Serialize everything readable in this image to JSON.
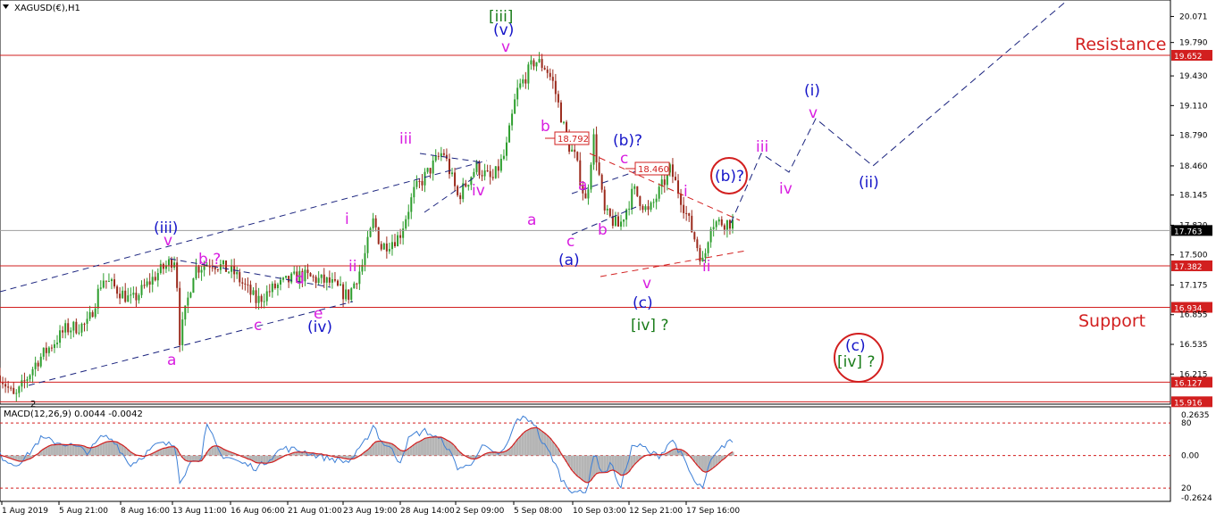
{
  "header": {
    "symbol_label": "XAGUSD(€),H1"
  },
  "colors": {
    "candle_up": "#2e9e2e",
    "candle_down": "#9b2a1c",
    "level_line": "#d21f1f",
    "trend_line": "#1a237e",
    "minor_wave": "#d81ee0",
    "major_wave": "#1515c8",
    "degree_wave": "#1b7d1b",
    "macd_line": "#3d7fd6",
    "macd_signal": "#d21f1f",
    "macd_hist": "#b5b5b5",
    "projection": "#1a237e",
    "annotation_text": "#d21f1f"
  },
  "chart_data": [
    {
      "type": "candlestick",
      "title": "XAGUSD(€),H1",
      "ylim": [
        15.9,
        20.21
      ],
      "y_ticks": [
        "20.071",
        "19.790",
        "19.652",
        "19.430",
        "19.110",
        "18.790",
        "18.460",
        "18.145",
        "17.820",
        "17.763",
        "17.500",
        "17.382",
        "17.175",
        "16.934",
        "16.855",
        "16.535",
        "16.215",
        "16.127",
        "15.916"
      ],
      "x_ticks": [
        "1 Aug 2019",
        "5 Aug 21:00",
        "8 Aug 16:00",
        "13 Aug 11:00",
        "16 Aug 06:00",
        "21 Aug 01:00",
        "23 Aug 19:00",
        "28 Aug 14:00",
        "2 Sep 09:00",
        "5 Sep 08:00",
        "10 Sep 03:00",
        "12 Sep 21:00",
        "17 Sep 16:00"
      ],
      "price_path": [
        {
          "t": 0,
          "p": 16.2
        },
        {
          "t": 0.02,
          "p": 15.95
        },
        {
          "t": 0.05,
          "p": 16.35
        },
        {
          "t": 0.09,
          "p": 16.7
        },
        {
          "t": 0.12,
          "p": 16.75
        },
        {
          "t": 0.14,
          "p": 17.25
        },
        {
          "t": 0.18,
          "p": 17.0
        },
        {
          "t": 0.215,
          "p": 17.3
        },
        {
          "t": 0.24,
          "p": 17.48
        },
        {
          "t": 0.245,
          "p": 16.58
        },
        {
          "t": 0.265,
          "p": 17.35
        },
        {
          "t": 0.29,
          "p": 17.42
        },
        {
          "t": 0.32,
          "p": 17.3
        },
        {
          "t": 0.35,
          "p": 17.0
        },
        {
          "t": 0.375,
          "p": 17.15
        },
        {
          "t": 0.41,
          "p": 17.28
        },
        {
          "t": 0.45,
          "p": 17.2
        },
        {
          "t": 0.475,
          "p": 17.05
        },
        {
          "t": 0.495,
          "p": 17.4
        },
        {
          "t": 0.51,
          "p": 17.88
        },
        {
          "t": 0.52,
          "p": 17.58
        },
        {
          "t": 0.545,
          "p": 17.7
        },
        {
          "t": 0.565,
          "p": 18.18
        },
        {
          "t": 0.605,
          "p": 18.62
        },
        {
          "t": 0.625,
          "p": 18.12
        },
        {
          "t": 0.65,
          "p": 18.45
        },
        {
          "t": 0.672,
          "p": 18.3
        },
        {
          "t": 0.69,
          "p": 18.6
        },
        {
          "t": 0.705,
          "p": 19.25
        },
        {
          "t": 0.73,
          "p": 19.6
        },
        {
          "t": 0.745,
          "p": 19.52
        },
        {
          "t": 0.755,
          "p": 19.35
        },
        {
          "t": 0.775,
          "p": 18.7
        },
        {
          "t": 0.785,
          "p": 18.55
        },
        {
          "t": 0.8,
          "p": 18.05
        },
        {
          "t": 0.81,
          "p": 18.78
        },
        {
          "t": 0.825,
          "p": 17.95
        },
        {
          "t": 0.845,
          "p": 17.8
        },
        {
          "t": 0.865,
          "p": 18.2
        },
        {
          "t": 0.885,
          "p": 17.95
        },
        {
          "t": 0.915,
          "p": 18.42
        },
        {
          "t": 0.93,
          "p": 18.1
        },
        {
          "t": 0.96,
          "p": 17.4
        },
        {
          "t": 0.97,
          "p": 17.85
        },
        {
          "t": 1.0,
          "p": 17.85
        }
      ],
      "horizontal_levels": [
        19.652,
        17.382,
        16.934,
        16.127,
        15.916
      ],
      "current_price": 17.763,
      "level_labels": [
        "19.652",
        "17.382",
        "16.934",
        "16.127",
        "15.916",
        "17.763"
      ],
      "annotations": {
        "resistance": "Resistance",
        "support": "Support",
        "box_1": "18.792",
        "box_2": "18.460"
      },
      "waves": {
        "iii_major": "[iii]",
        "v_major": "(v)",
        "v_minor_top": "v",
        "iii_circle": "(iii)",
        "v_left": "v",
        "a_low": "a",
        "b_q": "b ?",
        "c_left": "c",
        "d_left": "d",
        "e_left": "e",
        "iv_circle": "(iv)",
        "i_left": "i",
        "ii_left": "ii",
        "iii_left": "iii",
        "iv_left": "iv",
        "a_mid": "a",
        "b_mid": "b",
        "a_mid2": "a",
        "b_mid2": "b",
        "c_mid": "c",
        "a_big": "(a)",
        "b_big": "(b)?",
        "c_small": "c",
        "v_small": "v",
        "c_big": "(c)",
        "iv_deg": "[iv] ?",
        "i_small": "i",
        "ii_small": "ii",
        "b_circle": "(b)?",
        "iii_proj": "iii",
        "iv_proj": "iv",
        "v_proj": "v",
        "i_proj": "(i)",
        "ii_proj": "(ii)",
        "c_circle": "(c)",
        "iv_circle2": "[iv] ?",
        "num_2": "2"
      }
    },
    {
      "type": "macd",
      "title": "MACD(12,26,9) 0.0044 -0.0042",
      "y_ticks": [
        "0.2635",
        "80",
        "0.00",
        "20",
        "-0.2624"
      ],
      "ylim": [
        -0.2624,
        0.2635
      ]
    }
  ]
}
